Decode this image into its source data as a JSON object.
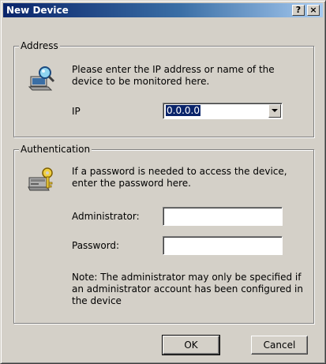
{
  "window": {
    "title": "New Device",
    "help_label": "?",
    "close_label": "×"
  },
  "address": {
    "legend": "Address",
    "icon": "monitor-search-icon",
    "description": "Please enter the IP address or name of the device to be monitored here.",
    "ip_label": "IP",
    "ip_value": "0.0.0.0"
  },
  "authentication": {
    "legend": "Authentication",
    "icon": "computer-key-icon",
    "description": "If a password is needed to access the device, enter the password here.",
    "administrator_label": "Administrator:",
    "administrator_value": "",
    "password_label": "Password:",
    "password_value": "",
    "note": "Note: The administrator may only be specified if an administrator account has been configured in the device"
  },
  "buttons": {
    "ok": "OK",
    "cancel": "Cancel"
  },
  "colors": {
    "titlebar_start": "#0a246a",
    "titlebar_end": "#a6caf0",
    "dialog_face": "#d4d0c8",
    "selection": "#0a246a"
  }
}
